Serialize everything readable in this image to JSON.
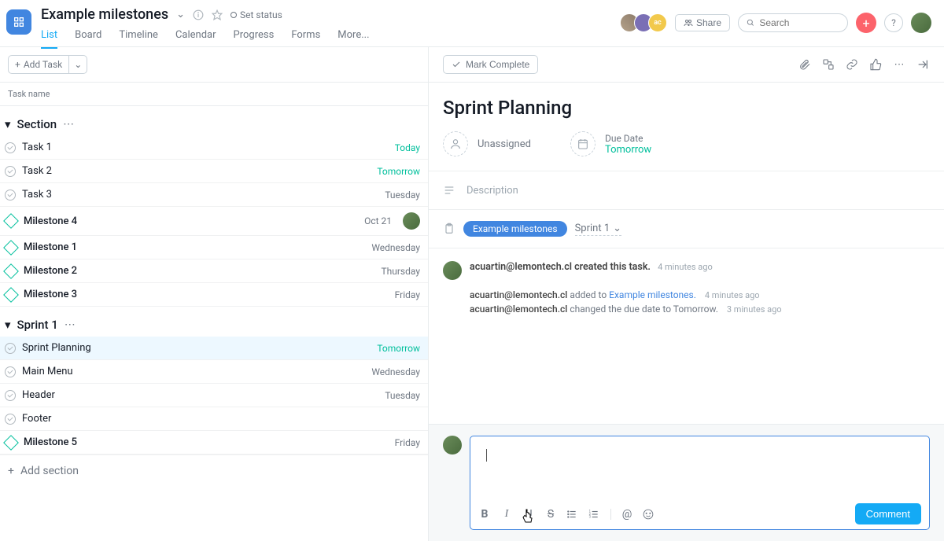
{
  "header": {
    "title": "Example milestones",
    "set_status": "Set status",
    "tabs": [
      "List",
      "Board",
      "Timeline",
      "Calendar",
      "Progress",
      "Forms",
      "More..."
    ],
    "active_tab_index": 0,
    "share_label": "Share",
    "search_placeholder": "Search",
    "avatar3_initials": "ac"
  },
  "left": {
    "add_task": "Add Task",
    "task_name_header": "Task name",
    "section1": "Section",
    "section2": "Sprint 1",
    "add_section": "Add section",
    "tasks_section1": [
      {
        "label": "Task 1",
        "due": "Today",
        "due_green": true,
        "milestone": false
      },
      {
        "label": "Task 2",
        "due": "Tomorrow",
        "due_green": true,
        "milestone": false
      },
      {
        "label": "Task 3",
        "due": "Tuesday",
        "due_green": false,
        "milestone": false
      },
      {
        "label": "Milestone 4",
        "due": "Oct 21",
        "due_green": false,
        "milestone": true,
        "has_assignee": true
      },
      {
        "label": "Milestone 1",
        "due": "Wednesday",
        "due_green": false,
        "milestone": true
      },
      {
        "label": "Milestone 2",
        "due": "Thursday",
        "due_green": false,
        "milestone": true
      },
      {
        "label": "Milestone 3",
        "due": "Friday",
        "due_green": false,
        "milestone": true
      }
    ],
    "tasks_section2": [
      {
        "label": "Sprint Planning",
        "due": "Tomorrow",
        "due_green": true,
        "milestone": false,
        "selected": true
      },
      {
        "label": "Main Menu",
        "due": "Wednesday",
        "due_green": false,
        "milestone": false
      },
      {
        "label": "Header",
        "due": "Tuesday",
        "due_green": false,
        "milestone": false
      },
      {
        "label": "Footer",
        "due": "",
        "due_green": false,
        "milestone": false
      },
      {
        "label": "Milestone 5",
        "due": "Friday",
        "due_green": false,
        "milestone": true
      }
    ]
  },
  "detail": {
    "mark_complete": "Mark Complete",
    "title": "Sprint Planning",
    "assignee_label": "Unassigned",
    "due_date_label": "Due Date",
    "due_date_value": "Tomorrow",
    "description_placeholder": "Description",
    "project_pill": "Example milestones",
    "section_link": "Sprint 1",
    "activity_created_user": "acuartin@lemontech.cl",
    "activity_created_text": "created this task.",
    "activity_created_time": "4 minutes ago",
    "activity_added_user": "acuartin@lemontech.cl",
    "activity_added_text": "added to",
    "activity_added_link": "Example milestones.",
    "activity_added_time": "4 minutes ago",
    "activity_due_user": "acuartin@lemontech.cl",
    "activity_due_text": "changed the due date to Tomorrow.",
    "activity_due_time": "3 minutes ago",
    "comment_button": "Comment"
  }
}
